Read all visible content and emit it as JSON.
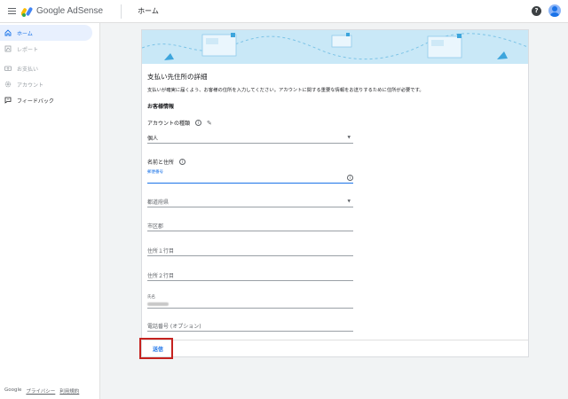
{
  "header": {
    "brand": "Google AdSense",
    "page_title": "ホーム",
    "help_icon": "help-circle-icon",
    "avatar_icon": "account-avatar-icon"
  },
  "sidebar": {
    "items": [
      {
        "label": "ホーム",
        "icon": "home-icon",
        "state": "active"
      },
      {
        "label": "レポート",
        "icon": "report-icon",
        "state": "disabled"
      },
      {
        "label": "お支払い",
        "icon": "payment-icon",
        "state": "disabled"
      },
      {
        "label": "アカウント",
        "icon": "settings-icon",
        "state": "disabled"
      },
      {
        "label": "フィードバック",
        "icon": "feedback-icon",
        "state": "normal"
      }
    ],
    "footer": {
      "google": "Google",
      "privacy": "プライバシー",
      "terms": "利用規約"
    }
  },
  "form": {
    "title": "支払い先住所の詳細",
    "description": "支払いが確実に届くよう、お客様の住所を入力してください。アカウントに関する重要な情報をお送りするために住所が必要です。",
    "customer_info": "お客様情報",
    "account_type_label": "アカウントの種類",
    "account_type_value": "個人",
    "name_address_label": "名前と住所",
    "postal_code_label": "郵便番号",
    "prefecture_placeholder": "都道府県",
    "city_placeholder": "市区郡",
    "address1_placeholder": "住所１行目",
    "address2_placeholder": "住所２行目",
    "name_label": "氏名",
    "phone_placeholder": "電話番号 (オプション)",
    "submit_label": "送信"
  },
  "colors": {
    "accent": "#1a73e8",
    "banner": "#c9e8f7",
    "highlight": "#c5221f"
  }
}
